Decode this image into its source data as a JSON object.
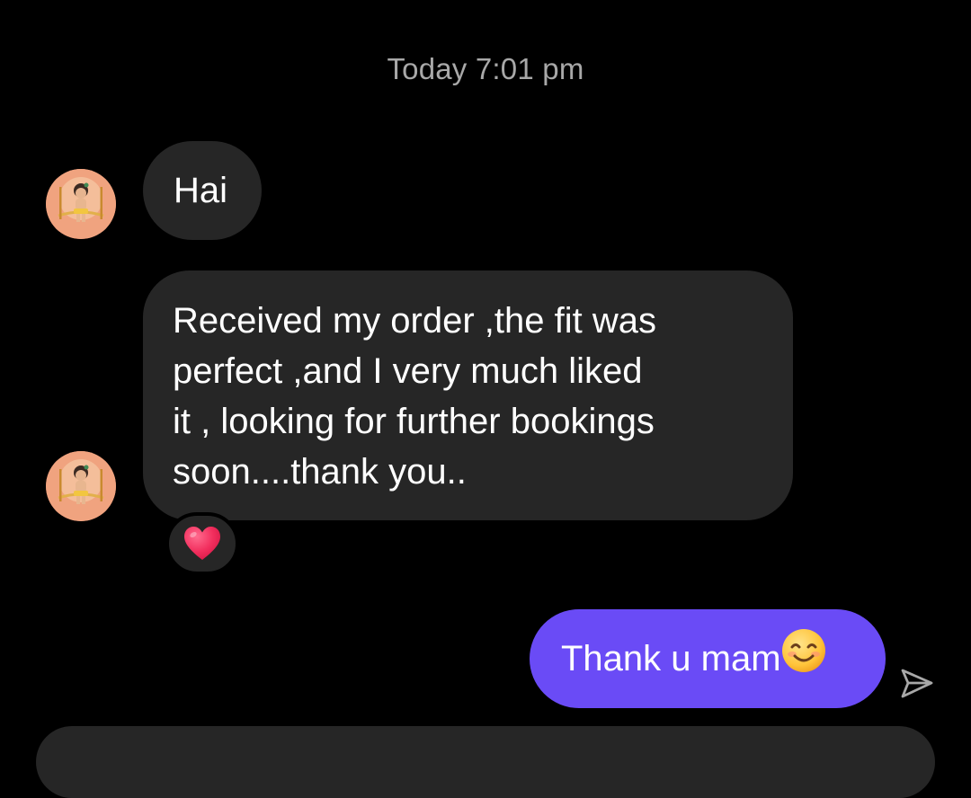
{
  "conversation": {
    "timestamp": "Today 7:01 pm",
    "messages": [
      {
        "direction": "incoming",
        "text": "Hai"
      },
      {
        "direction": "incoming",
        "lines": [
          "Received my order ,the fit was",
          "perfect ,and I very much liked",
          "it , looking for further bookings",
          "soon....thank you.."
        ],
        "reaction": "red-heart-emoji"
      },
      {
        "direction": "outgoing",
        "text": "Thank u mam",
        "emoji": "smiling-face-emoji",
        "status_icon": "sent-icon"
      }
    ]
  },
  "colors": {
    "background": "#000000",
    "incoming_bubble": "#262626",
    "outgoing_bubble": "#6a4bf6",
    "timestamp_text": "#a8a8a8"
  }
}
